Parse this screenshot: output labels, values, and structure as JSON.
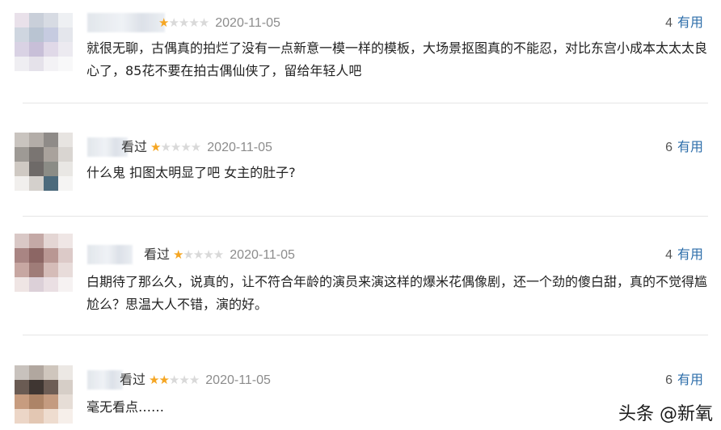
{
  "reviews": [
    {
      "watched": "",
      "stars": 1,
      "date": "2020-11-05",
      "useful_count": "4",
      "useful_label": "有用",
      "text": "就很无聊，古偶真的拍烂了没有一点新意一模一样的模板，大场景抠图真的不能忍，对比东宫小成本太太太良心了，85花不要在拍古偶仙侠了，留给年轻人吧"
    },
    {
      "watched": "看过",
      "stars": 1,
      "date": "2020-11-05",
      "useful_count": "6",
      "useful_label": "有用",
      "text": "什么鬼 扣图太明显了吧 女主的肚子?"
    },
    {
      "watched": "看过",
      "stars": 1,
      "date": "2020-11-05",
      "useful_count": "4",
      "useful_label": "有用",
      "text": "白期待了那么久，说真的，让不符合年龄的演员来演这样的爆米花偶像剧，还一个劲的傻白甜，真的不觉得尴尬么？思温大人不错，演的好。"
    },
    {
      "watched": "看过",
      "stars": 2,
      "date": "2020-11-05",
      "useful_count": "6",
      "useful_label": "有用",
      "text": "毫无看点……"
    }
  ],
  "watermark": "头条 @新氧",
  "colors": {
    "star_on": "#f5a623",
    "star_off": "#d9d9d9",
    "link": "#2d6eaa"
  }
}
